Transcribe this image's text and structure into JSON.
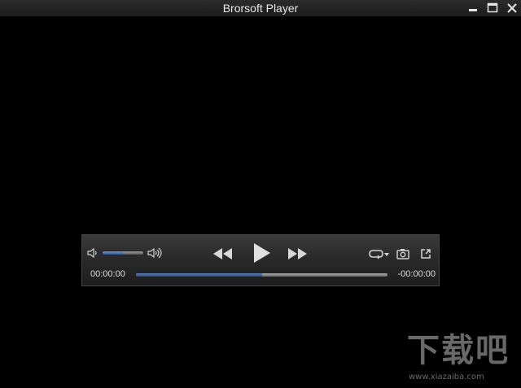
{
  "window": {
    "title": "Brorsoft Player"
  },
  "titlebar_buttons": {
    "minimize_icon": "minimize-icon",
    "maximize_icon": "maximize-icon",
    "close_icon": "close-icon"
  },
  "controls": {
    "time_elapsed": "00:00:00",
    "time_remaining": "-00:00:00",
    "volume_level": 0.5,
    "seek_progress": 0.5,
    "icons": [
      "speaker-low-icon",
      "speaker-high-icon",
      "rewind-icon",
      "play-icon",
      "fast-forward-icon",
      "loop-icon",
      "camera-icon",
      "popout-icon"
    ],
    "accent_color": "#3a6aa8"
  },
  "watermark": {
    "text": "下载吧",
    "url": "www.xiazaiba.com"
  }
}
